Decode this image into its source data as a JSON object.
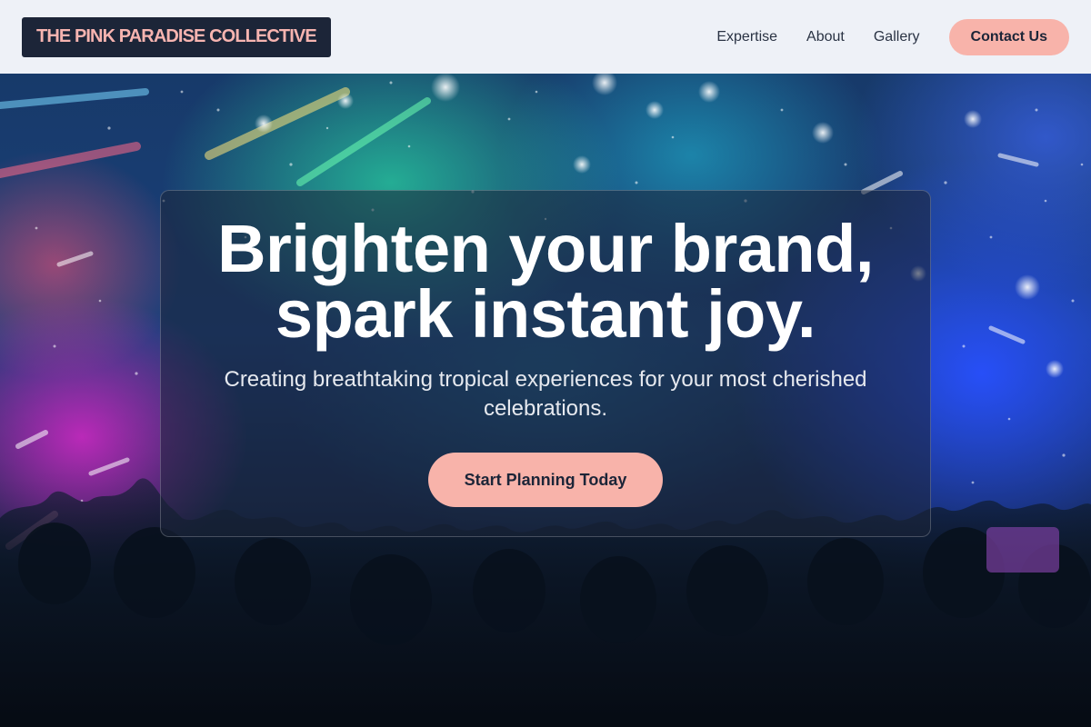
{
  "header": {
    "brand": "THE PINK PARADISE COLLECTIVE",
    "nav": [
      {
        "label": "Expertise"
      },
      {
        "label": "About"
      },
      {
        "label": "Gallery"
      }
    ],
    "contact_label": "Contact Us"
  },
  "hero": {
    "headline_line1": "Brighten your brand,",
    "headline_line2": "spark instant joy.",
    "subheadline": "Creating breathtaking tropical experiences for your most cherished celebrations.",
    "cta_label": "Start Planning Today",
    "background_image": "concert-crowd-with-stage-lights-and-confetti"
  },
  "colors": {
    "accent": "#f8b3aa",
    "brand_dark": "#1c2538",
    "header_bg": "#eef1f7"
  }
}
